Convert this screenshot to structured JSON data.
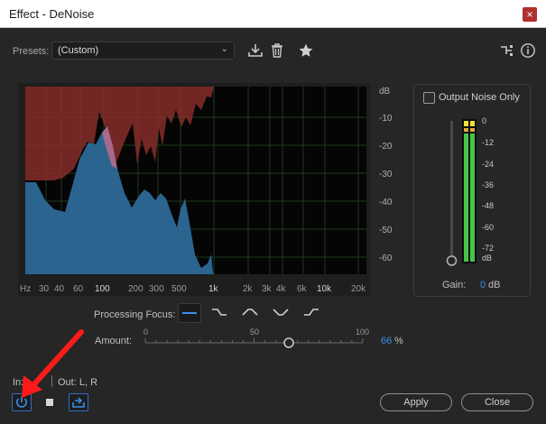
{
  "window": {
    "title": "Effect - DeNoise",
    "close_glyph": "×",
    "close_icon": "close-icon"
  },
  "presets": {
    "label": "Presets:",
    "value": "(Custom)",
    "icons": [
      "download-preset-icon",
      "trash-icon",
      "star-icon",
      "routing-icon",
      "info-icon"
    ]
  },
  "spectrum": {
    "db_ticks": [
      "dB",
      "-10",
      "-20",
      "-30",
      "-40",
      "-50",
      "-60"
    ],
    "freq_ticks": [
      "Hz",
      "30",
      "40",
      "60",
      "100",
      "200",
      "300",
      "500",
      "1k",
      "2k",
      "3k",
      "4k",
      "6k",
      "10k",
      "20k"
    ],
    "noise_color": "#8c2f2c",
    "signal_color": "#2f6f9e"
  },
  "output": {
    "checkbox_label": "Output Noise Only",
    "checked": false,
    "meter_ticks": [
      "0",
      "-12",
      "-24",
      "-36",
      "-48",
      "-60",
      "-72",
      "dB"
    ],
    "gain_label": "Gain:",
    "gain_value": "0",
    "gain_unit": "dB"
  },
  "processing": {
    "focus_label": "Processing Focus:",
    "focus_options": [
      "focus-all-icon",
      "focus-low-icon",
      "focus-mid-icon",
      "focus-cut-mid-icon",
      "focus-high-icon"
    ],
    "amount_label": "Amount:",
    "amount_ticks": [
      "0",
      "50",
      "100"
    ],
    "amount_value": "66",
    "amount_percent": 66,
    "amount_unit": "%"
  },
  "io": {
    "in_label": "In:",
    "out_label": "Out: L, R"
  },
  "buttons": {
    "apply": "Apply",
    "close": "Close"
  },
  "accent": "#3b8ee8"
}
